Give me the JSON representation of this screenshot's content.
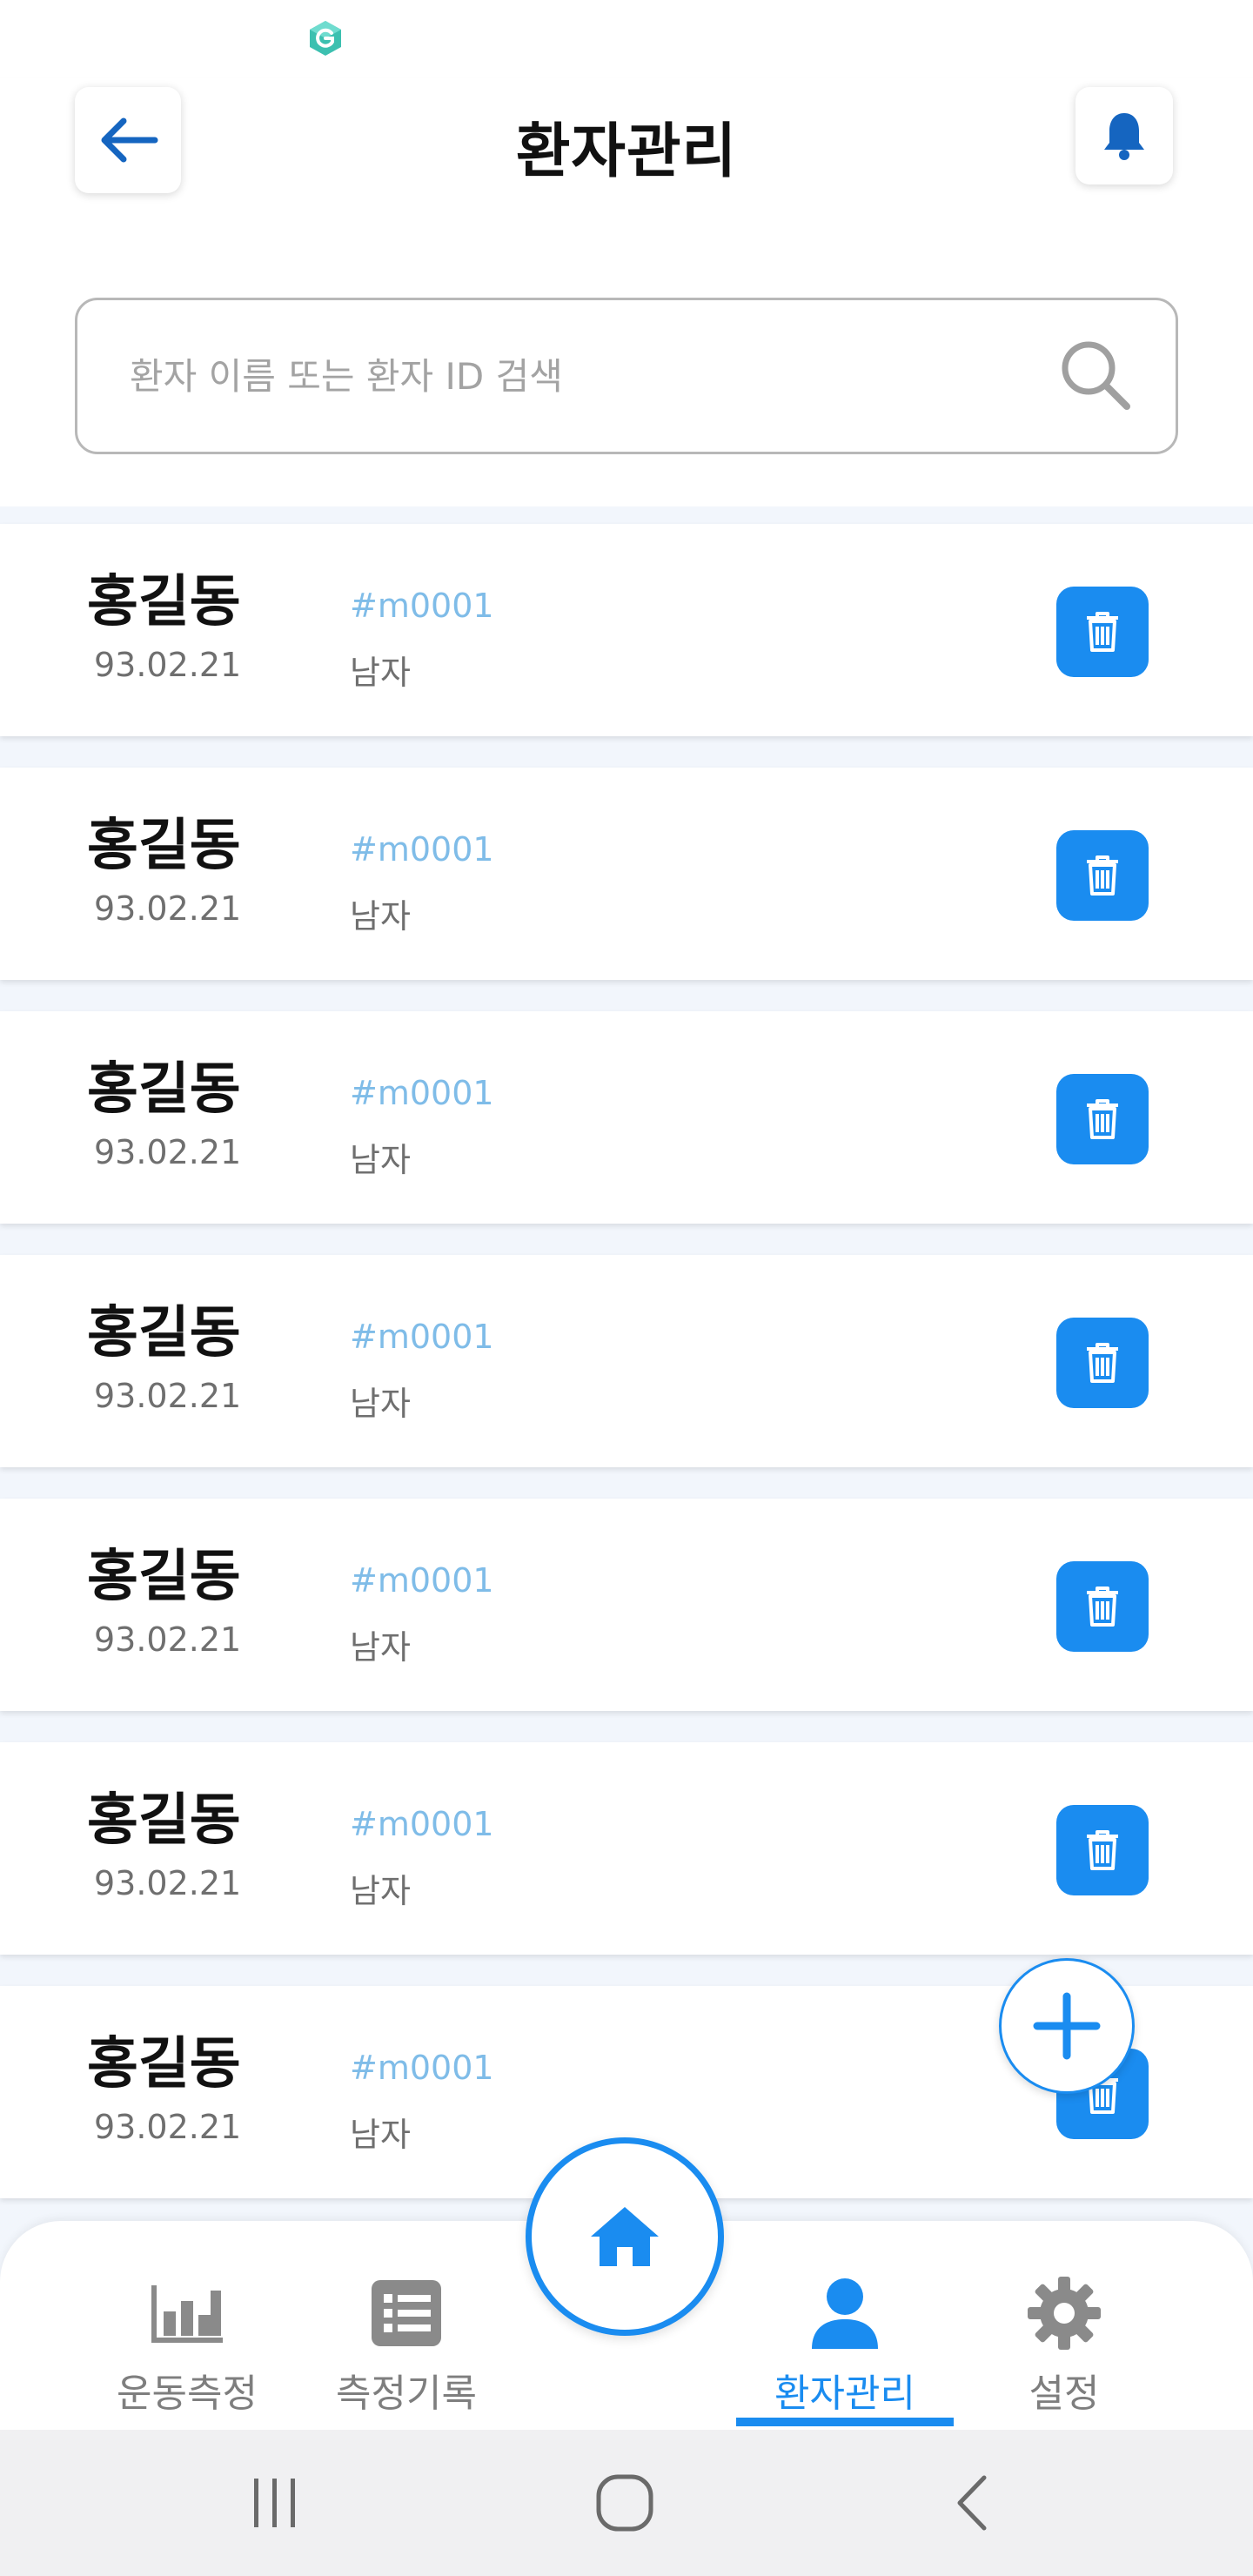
{
  "header": {
    "title": "환자관리"
  },
  "search": {
    "placeholder": "환자 이름 또는 환자 ID 검색"
  },
  "patients": [
    {
      "name": "홍길동",
      "birth": "93.02.21",
      "id": "#m0001",
      "gender": "남자"
    },
    {
      "name": "홍길동",
      "birth": "93.02.21",
      "id": "#m0001",
      "gender": "남자"
    },
    {
      "name": "홍길동",
      "birth": "93.02.21",
      "id": "#m0001",
      "gender": "남자"
    },
    {
      "name": "홍길동",
      "birth": "93.02.21",
      "id": "#m0001",
      "gender": "남자"
    },
    {
      "name": "홍길동",
      "birth": "93.02.21",
      "id": "#m0001",
      "gender": "남자"
    },
    {
      "name": "홍길동",
      "birth": "93.02.21",
      "id": "#m0001",
      "gender": "남자"
    },
    {
      "name": "홍길동",
      "birth": "93.02.21",
      "id": "#m0001",
      "gender": "남자"
    }
  ],
  "bottom_nav": {
    "items": [
      {
        "label": "운동측정",
        "icon": "bar-chart-icon"
      },
      {
        "label": "측정기록",
        "icon": "list-icon"
      },
      {
        "label": "환자관리",
        "icon": "person-icon",
        "active": true
      },
      {
        "label": "설정",
        "icon": "gear-icon"
      }
    ],
    "home_icon": "home-icon"
  },
  "colors": {
    "accent": "#1a8cf0",
    "id_text": "#7fbce8",
    "muted_text": "#6f6f6f"
  }
}
